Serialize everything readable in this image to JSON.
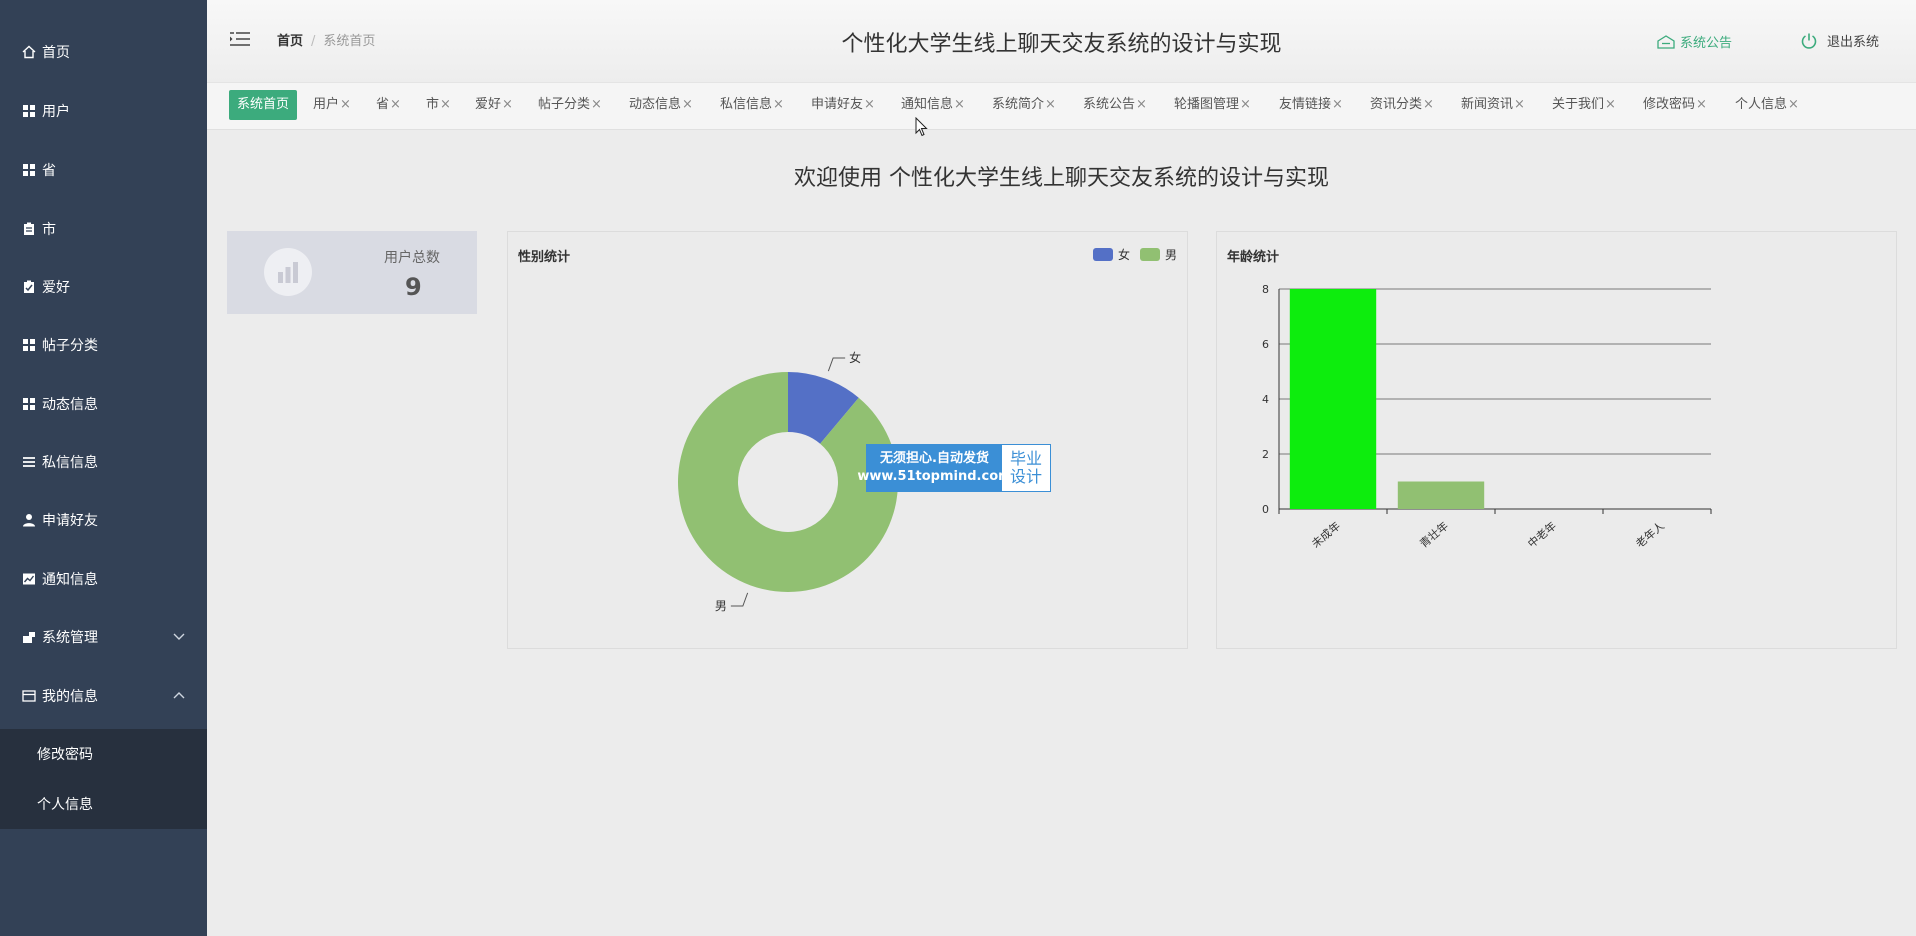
{
  "sidebar": {
    "items": [
      {
        "label": "首页",
        "icon": "home-icon"
      },
      {
        "label": "用户",
        "icon": "grid-icon"
      },
      {
        "label": "省",
        "icon": "grid-icon"
      },
      {
        "label": "市",
        "icon": "clipboard-icon"
      },
      {
        "label": "爱好",
        "icon": "checklist-icon"
      },
      {
        "label": "帖子分类",
        "icon": "grid-icon"
      },
      {
        "label": "动态信息",
        "icon": "grid-icon"
      },
      {
        "label": "私信信息",
        "icon": "list-icon"
      },
      {
        "label": "申请好友",
        "icon": "user-icon"
      },
      {
        "label": "通知信息",
        "icon": "chart-icon"
      },
      {
        "label": "系统管理",
        "icon": "settings-icon"
      },
      {
        "label": "我的信息",
        "icon": "wallet-icon"
      }
    ],
    "submenu": [
      "修改密码",
      "个人信息"
    ]
  },
  "header": {
    "breadcrumb_home": "首页",
    "breadcrumb_current": "系统首页",
    "title": "个性化大学生线上聊天交友系统的设计与实现",
    "notice_label": "系统公告",
    "logout_label": "退出系统"
  },
  "tabs": [
    "系统首页",
    "用户",
    "省",
    "市",
    "爱好",
    "帖子分类",
    "动态信息",
    "私信信息",
    "申请好友",
    "通知信息",
    "系统简介",
    "系统公告",
    "轮播图管理",
    "友情链接",
    "资讯分类",
    "新闻资讯",
    "关于我们",
    "修改密码",
    "个人信息"
  ],
  "tab_close_glyph": "×",
  "welcome": "欢迎使用 个性化大学生线上聊天交友系统的设计与实现",
  "user_card": {
    "label": "用户总数",
    "value": "9"
  },
  "watermark": {
    "line1": "无须担心.自动发货",
    "line2": "www.51topmind.com",
    "right1": "毕业",
    "right2": "设计"
  },
  "colors": {
    "sidebar": "#334156",
    "accent": "#3cab7d",
    "female": "#5470c6",
    "male": "#91c072",
    "bar_green": "#0ded0d"
  },
  "chart_data": [
    {
      "type": "pie",
      "title": "性别统计",
      "categories": [
        "女",
        "男"
      ],
      "values": [
        1,
        8
      ],
      "legend": "top-right",
      "donut": true
    },
    {
      "type": "bar",
      "title": "年龄统计",
      "categories": [
        "未成年",
        "青壮年",
        "中老年",
        "老年人"
      ],
      "values": [
        8,
        1,
        0,
        0
      ],
      "ylim": [
        0,
        8
      ],
      "yticks": [
        0,
        2,
        4,
        6,
        8
      ],
      "grid": true
    }
  ]
}
